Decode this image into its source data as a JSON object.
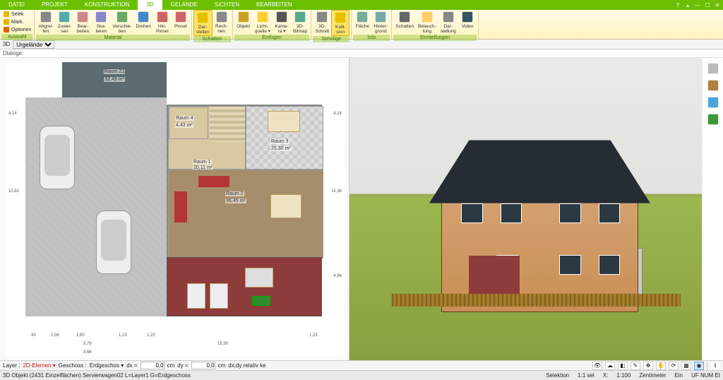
{
  "menu": {
    "tabs": [
      "DATEI",
      "PROJEKT",
      "KONSTRUKTION",
      "3D",
      "GELÄNDE",
      "SICHTEN",
      "BEARBEITEN"
    ],
    "active_index": 3
  },
  "ribbon": {
    "groups": [
      {
        "name": "Auswahl",
        "label": "Auswahl",
        "stack": [
          {
            "icon": "select-icon",
            "label": "Selek"
          },
          {
            "icon": "mark-icon",
            "label": "Mark."
          },
          {
            "icon": "options-icon",
            "label": "Optionen"
          }
        ]
      },
      {
        "name": "Material",
        "label": "Material",
        "buttons": [
          {
            "icon": "scissors-icon",
            "label": "Abgrei-\nfen"
          },
          {
            "icon": "assign-icon",
            "label": "Zuwei-\nsen"
          },
          {
            "icon": "edit-icon",
            "label": "Bear-\nbeiten"
          },
          {
            "icon": "scale-icon",
            "label": "Ska-\nlieren"
          },
          {
            "icon": "move-icon",
            "label": "Verschie-\nben"
          },
          {
            "icon": "rotate-icon",
            "label": "Drehen"
          },
          {
            "icon": "brush-icon",
            "label": "Hin.\nPinsel"
          },
          {
            "icon": "brush2-icon",
            "label": "Pinsel"
          }
        ]
      },
      {
        "name": "Schatten",
        "label": "Schatten",
        "buttons": [
          {
            "icon": "display-icon",
            "label": "Dar-\nstellen",
            "active": true
          },
          {
            "icon": "calc-icon",
            "label": "Rech-\nnen"
          }
        ]
      },
      {
        "name": "Einfügen",
        "label": "Einfügen",
        "buttons": [
          {
            "icon": "object-icon",
            "label": "Objekt"
          },
          {
            "icon": "light-icon",
            "label": "Licht-\nquelle ▾"
          },
          {
            "icon": "camera-icon",
            "label": "Kame-\nra ▾"
          },
          {
            "icon": "bitmap3d-icon",
            "label": "3D-\nBitmap"
          }
        ]
      },
      {
        "name": "Sonstige",
        "label": "Sonstige",
        "buttons": [
          {
            "icon": "section-icon",
            "label": "3D-\nSchnitt"
          },
          {
            "icon": "collision-icon",
            "label": "Kolli-\nsion",
            "active": true
          }
        ]
      },
      {
        "name": "Info",
        "label": "Info",
        "buttons": [
          {
            "icon": "area-icon",
            "label": "Fläche"
          },
          {
            "icon": "background-icon",
            "label": "Hinter-\ngrund"
          }
        ]
      },
      {
        "name": "Einstellungen",
        "label": "Einstellungen",
        "buttons": [
          {
            "icon": "shadow-icon",
            "label": "Schatten"
          },
          {
            "icon": "lighting-icon",
            "label": "Beleuch-\ntung"
          },
          {
            "icon": "display2-icon",
            "label": "Dar-\nstellung"
          },
          {
            "icon": "video-icon",
            "label": "Video"
          }
        ]
      }
    ]
  },
  "subbar": {
    "mode": "3D",
    "layer": "Urgelände"
  },
  "dlgbar": {
    "label": "Dialoge:"
  },
  "plan": {
    "garage_label": "Raum 21",
    "garage_area": "32,49 m²",
    "rooms": [
      {
        "key": "rm4",
        "label": "Raum 4",
        "area": "4,43 m²"
      },
      {
        "key": "rm1",
        "label": "Raum 1",
        "area": "20,11 m²"
      },
      {
        "key": "rm3",
        "label": "Raum 3",
        "area": "25,30 m²"
      },
      {
        "key": "rm2",
        "label": "Raum 2",
        "area": "36,45 m²"
      }
    ],
    "dims_left": [
      "4,14",
      "10,81"
    ],
    "dims_bottom": [
      "43",
      "2,06",
      "1,80",
      "1,23",
      "5,78",
      "9,66",
      "1,22",
      "15,50",
      "1,23"
    ],
    "dims_right": [
      "4,14",
      "11,36",
      "4,94"
    ]
  },
  "bottombar": {
    "layer_label": "Layer :",
    "layer_value": "2D-Elemen ▾",
    "floor_label": "Geschoss :",
    "floor_value": "Erdgeschos ▾",
    "dx_label": "dx =",
    "dx_value": "0,0",
    "dx_unit": "cm",
    "dy_label": "dy =",
    "dy_value": "0,0",
    "dy_unit": "cm",
    "rel": "dx,dy relativ ke",
    "info_btn": "i"
  },
  "statusbar": {
    "left": "3D Objekt (2431 Einzelflächen) Servierwagen02 L=Layer1 G=Erdgeschoss",
    "selection_label": "Selektion",
    "scale": "1:1 sel",
    "x_label": "X:",
    "scale2": "1:100",
    "unit": "Zentimeter",
    "mode": "Ein",
    "numlock": "UF NUM EI"
  },
  "side3d": {
    "buttons": [
      "layers-icon",
      "chair-icon",
      "wall-icon",
      "tree-icon"
    ]
  }
}
